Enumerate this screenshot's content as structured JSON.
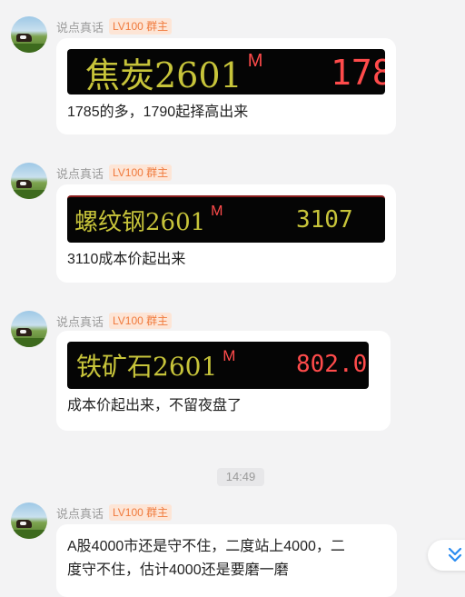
{
  "messages": [
    {
      "sender": "说点真话",
      "badge": "LV100 群主",
      "quote": {
        "name": "焦炭2601",
        "flag": "M",
        "price": "178"
      },
      "text": "1785的多，1790起择高出来"
    },
    {
      "sender": "说点真话",
      "badge": "LV100 群主",
      "quote": {
        "name": "螺纹钢2601",
        "flag": "M",
        "price": "3107"
      },
      "text": "3110成本价起出来"
    },
    {
      "sender": "说点真话",
      "badge": "LV100 群主",
      "quote": {
        "name": "铁矿石2601",
        "flag": "M",
        "price": "802.0"
      },
      "text": "成本价起出来，不留夜盘了"
    },
    {
      "sender": "说点真话",
      "badge": "LV100 群主",
      "text_line1": "A股4000市还是守不住，二度站上4000，二",
      "text_line2": "度守不住，估计4000还是要磨一磨"
    }
  ],
  "timestamp": "14:49",
  "colors": {
    "quote_name": "#c7c43a",
    "quote_up": "#ff4b4b",
    "badge_text": "#f07a3c",
    "badge_bg": "#fde5d6",
    "scroll_icon": "#2a8cf0"
  },
  "scroll_button": {
    "icon": "double-chevron-down-icon"
  }
}
